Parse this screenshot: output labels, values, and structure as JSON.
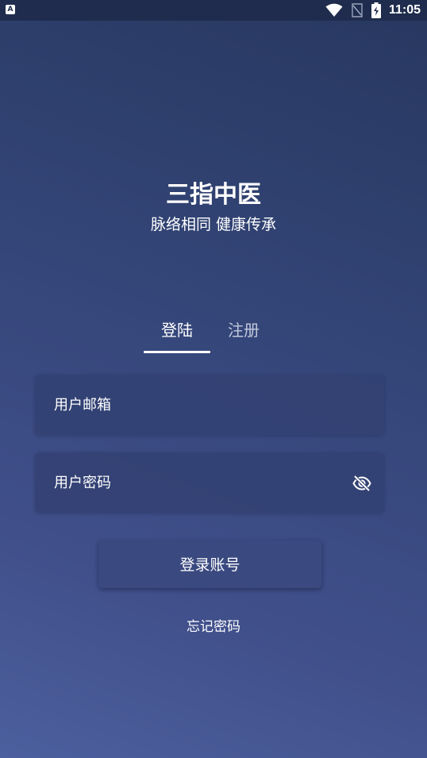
{
  "status_bar": {
    "left_icon_label": "A",
    "time": "11:05",
    "icons": [
      "wifi-icon",
      "no-sim-icon",
      "battery-charging-icon"
    ]
  },
  "header": {
    "title": "三指中医",
    "subtitle": "脉络相同 健康传承"
  },
  "tabs": {
    "items": [
      {
        "label": "登陆",
        "active": true
      },
      {
        "label": "注册",
        "active": false
      }
    ]
  },
  "form": {
    "email_placeholder": "用户邮箱",
    "password_placeholder": "用户密码",
    "password_visibility_icon": "eye-off-icon",
    "login_button": "登录账号",
    "forgot_password": "忘记密码"
  },
  "colors": {
    "background_top": "#27375f",
    "background_bottom": "#4c5f9e",
    "field_background": "#334172",
    "button_background": "#3a4a80",
    "inactive_tab": "#c3c9dc"
  }
}
